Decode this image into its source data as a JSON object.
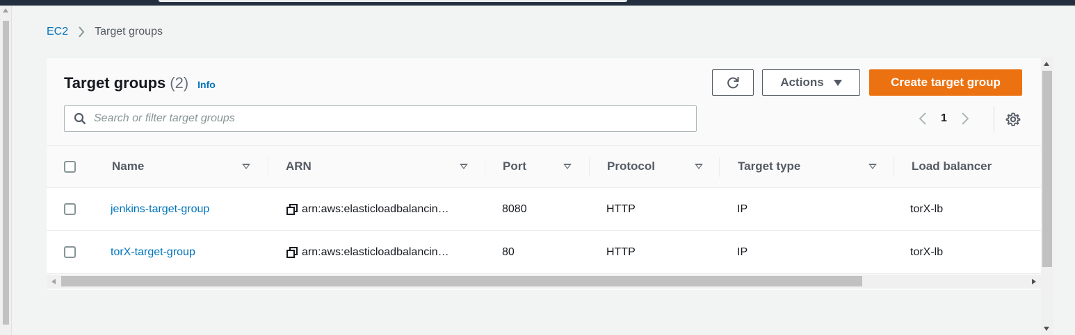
{
  "breadcrumb": {
    "root": "EC2",
    "current": "Target groups"
  },
  "panel": {
    "title": "Target groups",
    "count": "(2)",
    "info": "Info"
  },
  "buttons": {
    "refresh_icon": "refresh-icon",
    "actions": "Actions",
    "create": "Create target group"
  },
  "search": {
    "placeholder": "Search or filter target groups",
    "value": ""
  },
  "pagination": {
    "current_page": "1"
  },
  "table": {
    "columns": [
      "Name",
      "ARN",
      "Port",
      "Protocol",
      "Target type",
      "Load balancer"
    ],
    "rows": [
      {
        "name": "jenkins-target-group",
        "arn": "arn:aws:elasticloadbalancin…",
        "port": "8080",
        "protocol": "HTTP",
        "target_type": "IP",
        "load_balancer": "torX-lb"
      },
      {
        "name": "torX-target-group",
        "arn": "arn:aws:elasticloadbalancin…",
        "port": "80",
        "protocol": "HTTP",
        "target_type": "IP",
        "load_balancer": "torX-lb"
      }
    ]
  },
  "colors": {
    "accent_orange": "#ec7211",
    "link_blue": "#0073bb",
    "top_nav": "#232f3e"
  }
}
